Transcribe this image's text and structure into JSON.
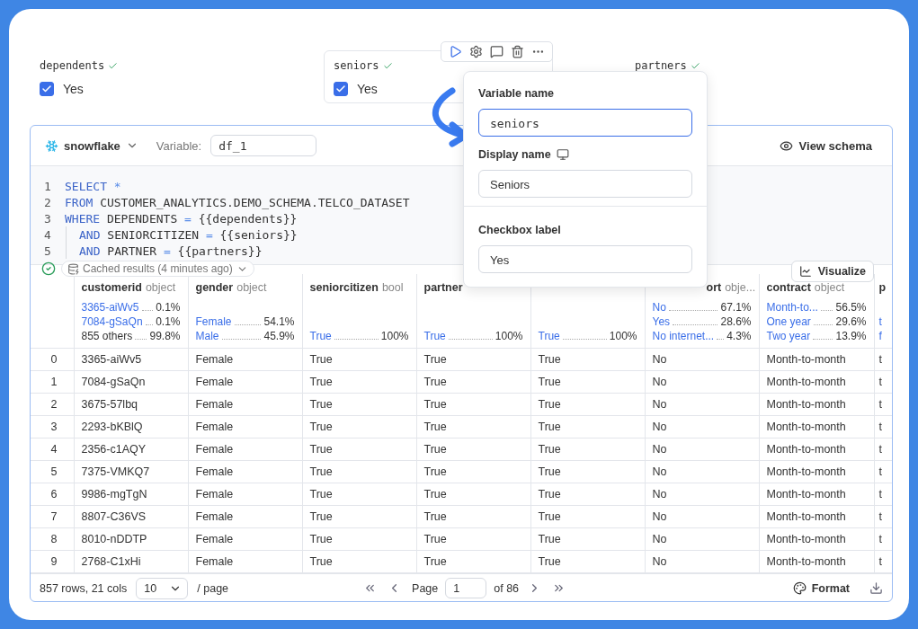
{
  "variables": [
    {
      "name": "dependents",
      "valid": true,
      "label": "Yes",
      "checked": true,
      "selected": false
    },
    {
      "name": "seniors",
      "valid": true,
      "label": "Yes",
      "checked": true,
      "selected": true
    },
    {
      "name": "partners",
      "valid": true,
      "selected": false
    }
  ],
  "popover": {
    "fields": [
      {
        "label": "Variable name",
        "value": "seniors",
        "kind": "code",
        "focused": true
      },
      {
        "label": "Display name",
        "value": "Seniors",
        "kind": "text",
        "focused": false,
        "info_icon": true
      },
      {
        "label": "Checkbox label",
        "value": "Yes",
        "kind": "text",
        "focused": false,
        "divider_above": true
      }
    ]
  },
  "sql_cell": {
    "source": "snowflake",
    "variable_label": "Variable:",
    "variable": "df_1",
    "view_schema": "View schema",
    "code": [
      {
        "number": "1",
        "indent": false,
        "tokens": [
          {
            "kind": "keyword",
            "text": "SELECT"
          },
          {
            "kind": "operator",
            "text": " *"
          }
        ]
      },
      {
        "number": "2",
        "indent": false,
        "tokens": [
          {
            "kind": "keyword",
            "text": "FROM"
          },
          {
            "kind": "plain",
            "text": " CUSTOMER_ANALYTICS.DEMO_SCHEMA.TELCO_DATASET"
          }
        ]
      },
      {
        "number": "3",
        "indent": false,
        "tokens": [
          {
            "kind": "keyword",
            "text": "WHERE"
          },
          {
            "kind": "plain",
            "text": " DEPENDENTS "
          },
          {
            "kind": "operator",
            "text": "="
          },
          {
            "kind": "plain",
            "text": " {{dependents}}"
          }
        ]
      },
      {
        "number": "4",
        "indent": true,
        "tokens": [
          {
            "kind": "keyword",
            "text": "AND"
          },
          {
            "kind": "plain",
            "text": " SENIORCITIZEN "
          },
          {
            "kind": "operator",
            "text": "="
          },
          {
            "kind": "plain",
            "text": " {{seniors}}"
          }
        ]
      },
      {
        "number": "5",
        "indent": true,
        "tokens": [
          {
            "kind": "keyword",
            "text": "AND"
          },
          {
            "kind": "plain",
            "text": " PARTNER "
          },
          {
            "kind": "operator",
            "text": "="
          },
          {
            "kind": "plain",
            "text": " {{partners}}"
          }
        ]
      }
    ]
  },
  "status": {
    "ok": true,
    "cache_label": "Cached results (4 minutes ago)"
  },
  "visualize": "Visualize",
  "table": {
    "columns": [
      {
        "name": "customerid",
        "type": "object",
        "stats": [
          {
            "value": "3365-aiWv5",
            "pct": "0.1%",
            "kind": "link"
          },
          {
            "value": "7084-gSaQn",
            "pct": "0.1%",
            "kind": "link"
          },
          {
            "value": "855 others",
            "pct": "99.8%",
            "kind": "plain"
          }
        ]
      },
      {
        "name": "gender",
        "type": "object",
        "stats": [
          {
            "value": "Female",
            "pct": "54.1%",
            "kind": "link"
          },
          {
            "value": "Male",
            "pct": "45.9%",
            "kind": "link"
          }
        ]
      },
      {
        "name": "seniorcitizen",
        "type": "bool",
        "stats": [
          {
            "value": "True",
            "pct": "100%",
            "kind": "link"
          }
        ]
      },
      {
        "name": "partner",
        "stats": [
          {
            "value": "True",
            "pct": "100%",
            "kind": "link"
          }
        ]
      },
      {
        "stats": [
          {
            "value": "True",
            "pct": "100%",
            "kind": "link"
          }
        ]
      },
      {
        "name": "ort",
        "type": "obje...",
        "stats": [
          {
            "value": "No",
            "pct": "67.1%",
            "kind": "link"
          },
          {
            "value": "Yes",
            "pct": "28.6%",
            "kind": "link"
          },
          {
            "value": "No internet...",
            "pct": "4.3%",
            "kind": "link"
          }
        ]
      },
      {
        "name": "contract",
        "type": "object",
        "stats": [
          {
            "value": "Month-to...",
            "pct": "56.5%",
            "kind": "link"
          },
          {
            "value": "One year",
            "pct": "29.6%",
            "kind": "link"
          },
          {
            "value": "Two year",
            "pct": "13.9%",
            "kind": "link"
          }
        ]
      },
      {
        "name": "p",
        "stats": [
          {
            "value": "t",
            "kind": "link"
          },
          {
            "value": "f",
            "kind": "link"
          }
        ]
      }
    ],
    "rows": [
      {
        "index": "0",
        "cells": [
          "3365-aiWv5",
          "Female",
          "True",
          "True",
          "True",
          "No",
          "Month-to-month",
          "t"
        ]
      },
      {
        "index": "1",
        "cells": [
          "7084-gSaQn",
          "Female",
          "True",
          "True",
          "True",
          "No",
          "Month-to-month",
          "t"
        ]
      },
      {
        "index": "2",
        "cells": [
          "3675-57lbq",
          "Female",
          "True",
          "True",
          "True",
          "No",
          "Month-to-month",
          "t"
        ]
      },
      {
        "index": "3",
        "cells": [
          "2293-bKBlQ",
          "Female",
          "True",
          "True",
          "True",
          "No",
          "Month-to-month",
          "t"
        ]
      },
      {
        "index": "4",
        "cells": [
          "2356-c1AQY",
          "Female",
          "True",
          "True",
          "True",
          "No",
          "Month-to-month",
          "t"
        ]
      },
      {
        "index": "5",
        "cells": [
          "7375-VMKQ7",
          "Female",
          "True",
          "True",
          "True",
          "No",
          "Month-to-month",
          "t"
        ]
      },
      {
        "index": "6",
        "cells": [
          "9986-mgTgN",
          "Female",
          "True",
          "True",
          "True",
          "No",
          "Month-to-month",
          "t"
        ]
      },
      {
        "index": "7",
        "cells": [
          "8807-C36VS",
          "Female",
          "True",
          "True",
          "True",
          "No",
          "Month-to-month",
          "t"
        ]
      },
      {
        "index": "8",
        "cells": [
          "8010-nDDTP",
          "Female",
          "True",
          "True",
          "True",
          "No",
          "Month-to-month",
          "t"
        ]
      },
      {
        "index": "9",
        "cells": [
          "2768-C1xHi",
          "Female",
          "True",
          "True",
          "True",
          "No",
          "Month-to-month",
          "t"
        ]
      }
    ]
  },
  "footer": {
    "summary": "857 rows, 21 cols",
    "page_size": "10",
    "per_page": "/ page",
    "page_label": "Page",
    "page": "1",
    "of": "of 86",
    "format": "Format"
  }
}
